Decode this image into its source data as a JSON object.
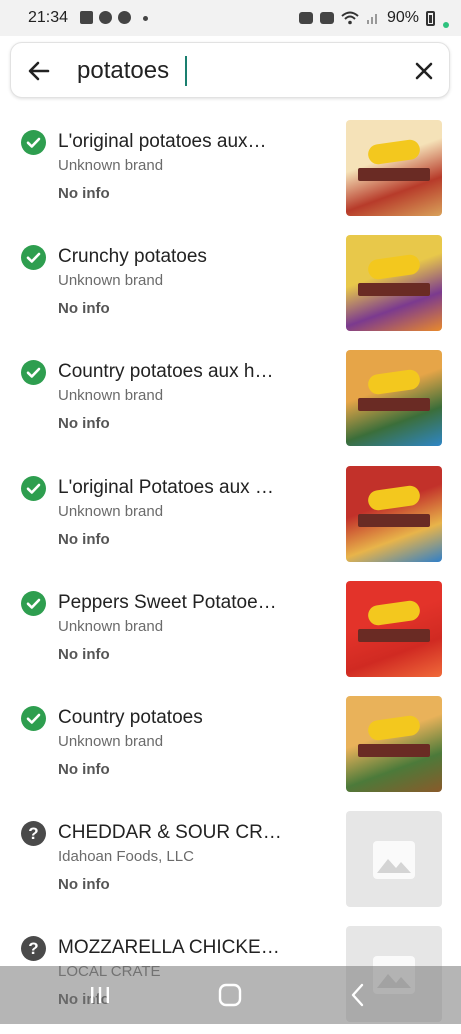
{
  "status_bar": {
    "time": "21:34",
    "battery": "90%",
    "icons_left": [
      "gallery-icon",
      "whatsapp-icon",
      "notification-icon",
      "dot-icon"
    ],
    "icons_right": [
      "alarm-icon",
      "mute-icon",
      "wifi-icon",
      "signal-icon",
      "battery-icon"
    ]
  },
  "search": {
    "value": "potatoes",
    "back_icon": "arrow-left-icon",
    "clear_icon": "close-icon"
  },
  "colors": {
    "ok_green": "#2e9e4f",
    "unknown_gray": "#4a4a4a",
    "caret": "#1a7f6f"
  },
  "results": [
    {
      "title": "L'original  potatoes aux…",
      "brand": "Unknown brand",
      "info": "No info",
      "status": "ok",
      "image": "product",
      "palette": [
        "#f5e2b8",
        "#b73b2a",
        "#d9a25a"
      ]
    },
    {
      "title": "Crunchy potatoes",
      "brand": "Unknown brand",
      "info": "No info",
      "status": "ok",
      "image": "product",
      "palette": [
        "#e8c84a",
        "#7b3a8f",
        "#e98a2c"
      ]
    },
    {
      "title": "Country potatoes aux h…",
      "brand": "Unknown brand",
      "info": "No info",
      "status": "ok",
      "image": "product",
      "palette": [
        "#e6a548",
        "#3b6e3a",
        "#2f86c6"
      ]
    },
    {
      "title": "L'original Potatoes aux …",
      "brand": "Unknown brand",
      "info": "No info",
      "status": "ok",
      "image": "product",
      "palette": [
        "#c2312a",
        "#e8b44a",
        "#2f7fc9"
      ]
    },
    {
      "title": "Peppers Sweet Potatoe…",
      "brand": "Unknown brand",
      "info": "No info",
      "status": "ok",
      "image": "product",
      "palette": [
        "#e3332a",
        "#d02a22",
        "#f06a3a"
      ]
    },
    {
      "title": "Country potatoes",
      "brand": "Unknown brand",
      "info": "No info",
      "status": "ok",
      "image": "product",
      "palette": [
        "#e9b25a",
        "#4c7a3a",
        "#8a5a2a"
      ]
    },
    {
      "title": "CHEDDAR & SOUR CR…",
      "brand": "Idahoan Foods, LLC",
      "info": "No info",
      "status": "unknown",
      "image": "placeholder"
    },
    {
      "title": "MOZZARELLA CHICKE…",
      "brand": "LOCAL CRATE",
      "info": "No info",
      "status": "unknown",
      "image": "placeholder"
    }
  ],
  "navbar": {
    "buttons": [
      "recent-apps-icon",
      "home-icon",
      "back-icon"
    ]
  }
}
